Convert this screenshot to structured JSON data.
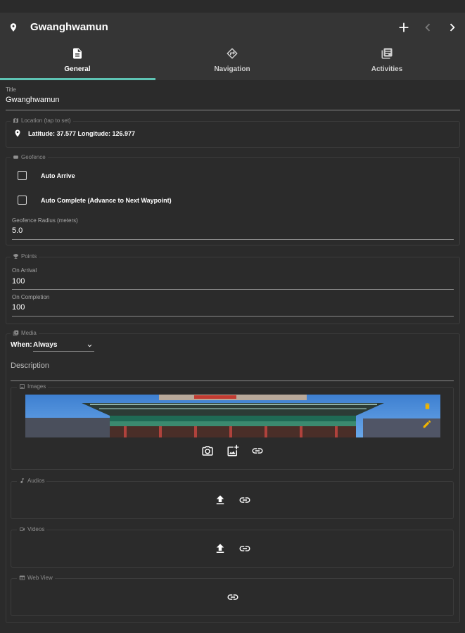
{
  "header": {
    "title": "Gwanghwamun",
    "icons": {
      "pin": "location-pin-icon",
      "add": "plus-icon",
      "prev": "chevron-left-icon",
      "next": "chevron-right-icon"
    }
  },
  "tabs": [
    {
      "label": "General",
      "icon": "document-icon",
      "active": true
    },
    {
      "label": "Navigation",
      "icon": "directions-icon",
      "active": false
    },
    {
      "label": "Activities",
      "icon": "library-icon",
      "active": false
    }
  ],
  "title_field": {
    "label": "Title",
    "value": "Gwanghwamun"
  },
  "location": {
    "legend": "Location (tap to set)",
    "value": "Latitude: 37.577 Longitude: 126.977"
  },
  "geofence": {
    "legend": "Geofence",
    "auto_arrive": {
      "label": "Auto Arrive",
      "checked": false
    },
    "auto_complete": {
      "label": "Auto Complete (Advance to Next Waypoint)",
      "checked": false
    },
    "radius": {
      "label": "Geofence Radius (meters)",
      "value": "5.0"
    }
  },
  "points": {
    "legend": "Points",
    "on_arrival": {
      "label": "On Arrival",
      "value": "100"
    },
    "on_completion": {
      "label": "On Completion",
      "value": "100"
    }
  },
  "media": {
    "legend": "Media",
    "when": {
      "label": "When:",
      "selected": "Always"
    },
    "description_placeholder": "Description",
    "images": {
      "legend": "Images",
      "actions": [
        "camera-icon",
        "add-photo-icon",
        "link-icon"
      ]
    },
    "audios": {
      "legend": "Audios",
      "actions": [
        "upload-icon",
        "link-icon"
      ]
    },
    "videos": {
      "legend": "Videos",
      "actions": [
        "upload-icon",
        "link-icon"
      ]
    },
    "web_view": {
      "legend": "Web View",
      "actions": [
        "link-icon"
      ]
    }
  },
  "colors": {
    "accent": "#5ec4b4",
    "background": "#2b2b2b",
    "appbar": "#353535",
    "delete": "#f0b400",
    "edit": "#f0b400"
  }
}
